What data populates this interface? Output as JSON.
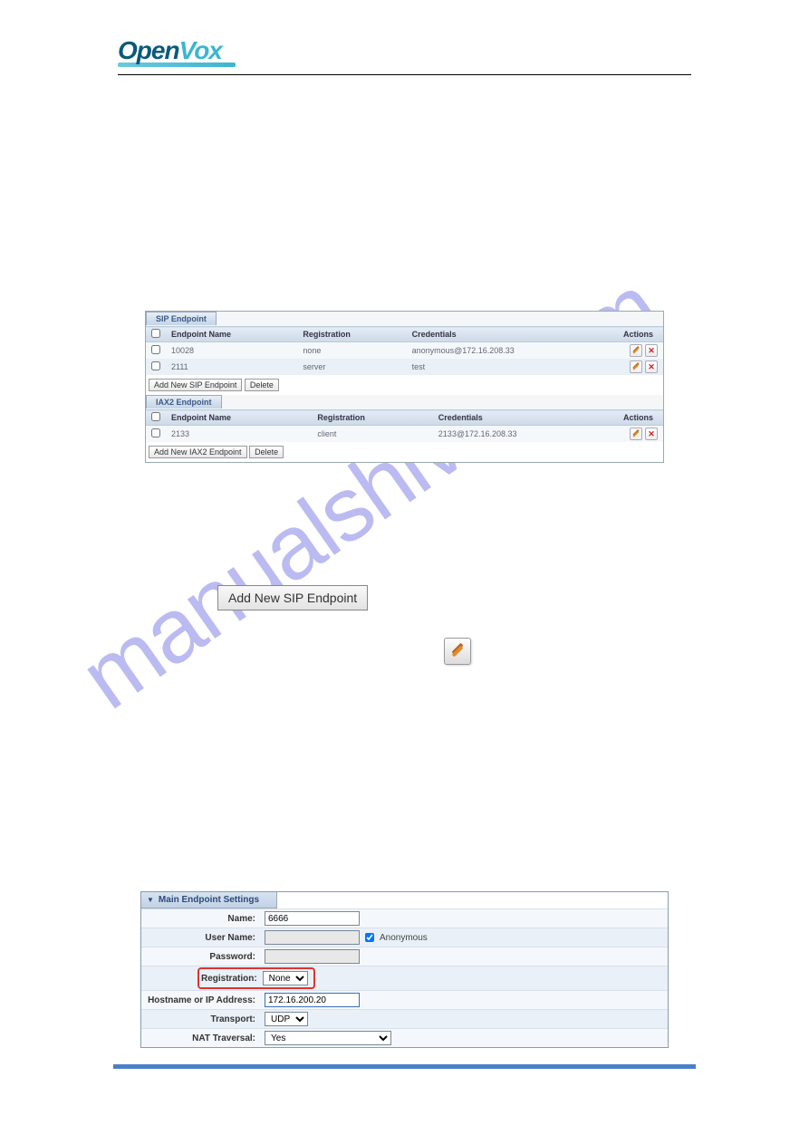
{
  "logo_text_a": "Open",
  "logo_text_b": "Vox",
  "watermark": "manualshive.com",
  "sip": {
    "tab": "SIP Endpoint",
    "cols": {
      "name": "Endpoint Name",
      "reg": "Registration",
      "cred": "Credentials",
      "actions": "Actions"
    },
    "rows": [
      {
        "name": "10028",
        "reg": "none",
        "cred": "anonymous@172.16.208.33"
      },
      {
        "name": "2111",
        "reg": "server",
        "cred": "test"
      }
    ],
    "add_btn": "Add New SIP Endpoint",
    "del_btn": "Delete"
  },
  "iax": {
    "tab": "IAX2 Endpoint",
    "cols": {
      "name": "Endpoint Name",
      "reg": "Registration",
      "cred": "Credentials",
      "actions": "Actions"
    },
    "rows": [
      {
        "name": "2133",
        "reg": "client",
        "cred": "2133@172.16.208.33"
      }
    ],
    "add_btn": "Add New IAX2 Endpoint",
    "del_btn": "Delete"
  },
  "inline_button": "Add New SIP Endpoint",
  "settings": {
    "title": "Main Endpoint Settings",
    "labels": {
      "name": "Name:",
      "user": "User Name:",
      "pass": "Password:",
      "reg": "Registration:",
      "host": "Hostname or IP Address:",
      "transport": "Transport:",
      "nat": "NAT Traversal:"
    },
    "values": {
      "name": "6666",
      "user": "",
      "pass": "",
      "reg": "None",
      "host": "172.16.200.20",
      "transport": "UDP",
      "nat": "Yes"
    },
    "anonymous": "Anonymous"
  }
}
